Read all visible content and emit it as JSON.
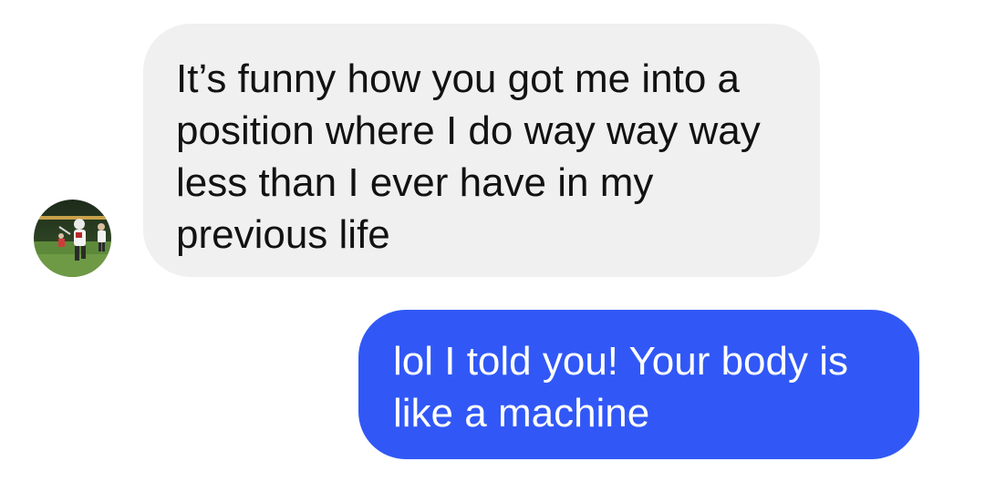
{
  "conversation": {
    "contact_avatar_icon": "contact-avatar-photo",
    "messages": [
      {
        "sender": "contact",
        "text": "It’s funny how you got me into a position where I do way way way less than I ever have in my previous life"
      },
      {
        "sender": "me",
        "text": "lol I told you! Your body is like a machine"
      }
    ]
  },
  "colors": {
    "incoming_bubble": "#f0f0f0",
    "incoming_text": "#121212",
    "outgoing_bubble": "#3158f6",
    "outgoing_text": "#ffffff",
    "background": "#ffffff"
  }
}
